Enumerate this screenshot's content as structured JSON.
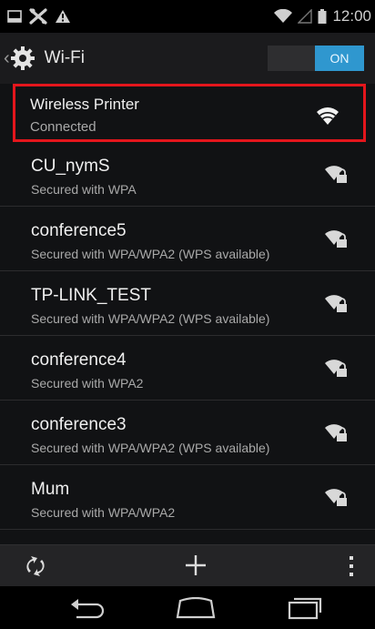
{
  "status_bar": {
    "time": "12:00",
    "icons": [
      "image-notification-icon",
      "tools-icon",
      "warning-icon",
      "wifi-signal-icon",
      "cell-signal-icon",
      "battery-icon"
    ]
  },
  "action_bar": {
    "title": "Wi-Fi",
    "toggle_label": "ON",
    "accent_color": "#2f97cf"
  },
  "networks": [
    {
      "name": "Wireless Printer",
      "status": "Connected",
      "secured": false,
      "connected": true
    },
    {
      "name": "CU_nymS",
      "status": "Secured with WPA",
      "secured": true,
      "connected": false
    },
    {
      "name": "conference5",
      "status": "Secured with WPA/WPA2 (WPS available)",
      "secured": true,
      "connected": false
    },
    {
      "name": "TP-LINK_TEST",
      "status": "Secured with WPA/WPA2 (WPS available)",
      "secured": true,
      "connected": false
    },
    {
      "name": "conference4",
      "status": "Secured with WPA2",
      "secured": true,
      "connected": false
    },
    {
      "name": "conference3",
      "status": "Secured with WPA/WPA2 (WPS available)",
      "secured": true,
      "connected": false
    },
    {
      "name": "Mum",
      "status": "Secured with WPA/WPA2",
      "secured": true,
      "connected": false
    }
  ],
  "highlight_color": "#e4161c",
  "toolbar": {
    "icons": [
      "wps-icon",
      "add-network-icon",
      "overflow-menu-icon"
    ]
  },
  "nav_bar": {
    "icons": [
      "back-icon",
      "home-icon",
      "recent-apps-icon"
    ]
  }
}
